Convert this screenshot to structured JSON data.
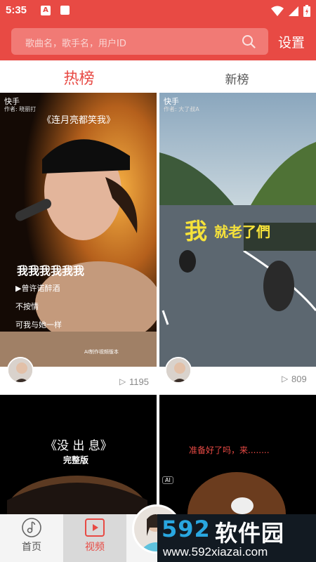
{
  "status_bar": {
    "time": "5:35",
    "notif_letter": "A"
  },
  "header": {
    "search_placeholder": "歌曲名，歌手名，用户ID",
    "settings_label": "设置"
  },
  "tabs": [
    {
      "label": "热榜",
      "active": true
    },
    {
      "label": "新榜",
      "active": false
    }
  ],
  "videos": [
    {
      "source": "快手",
      "author": "作者: 晓丽打",
      "title": "《连月亮都笑我》",
      "caption_big": "我我我我我我",
      "caption_lines": [
        "▶曾许诺醉酒",
        "不按情",
        "可我与她一样"
      ],
      "footer_tag": "AI制作视频版本",
      "plays": "1195"
    },
    {
      "source": "快手",
      "author": "作者: 大了叔A",
      "caption_big": "我",
      "caption_rest": "就老了們",
      "plays": "809"
    },
    {
      "title": "《没 出 息》",
      "subtitle": "完整版"
    },
    {
      "badge": "AI",
      "caption": "准备好了吗，来........"
    }
  ],
  "bottom_nav": [
    {
      "label": "首页",
      "icon": "music-note-icon",
      "active": false
    },
    {
      "label": "视频",
      "icon": "play-icon",
      "active": true
    }
  ],
  "watermark": {
    "brand_num": "592",
    "brand_text": "软件园",
    "url": "www.592xiazai.com"
  },
  "colors": {
    "accent": "#e84a44",
    "header_bg": "#e84a44",
    "watermark_bg": "#121a22"
  }
}
